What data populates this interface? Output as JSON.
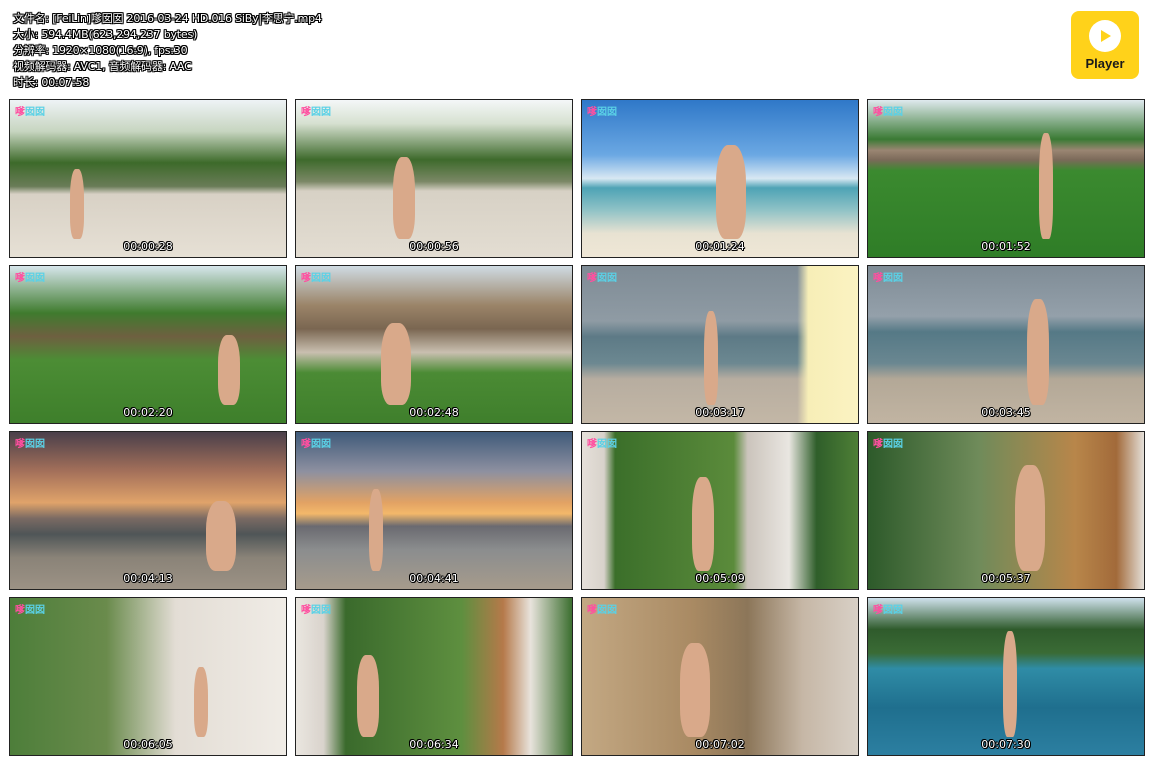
{
  "meta": {
    "filename": "文件名: [FeiLin]嗲囡囡 2016-03-24 HD.016 SiBy|李思宁.mp4",
    "size": "大小: 594.4MB(623,294,237 bytes)",
    "resolution": "分辨率: 1920×1080(16:9), fps:30",
    "codecs": "视频解码器: AVC1, 音频解码器: AAC",
    "duration": "时长: 00:07:58"
  },
  "player": {
    "label": "Player",
    "icon": "play-icon",
    "color": "#ffd21a"
  },
  "logo": {
    "primary": "嗲",
    "secondary": "囡囡"
  },
  "thumbnails": [
    {
      "time": "00:00:28",
      "scene": "s-palm-sand"
    },
    {
      "time": "00:00:56",
      "scene": "s-palm-sand2"
    },
    {
      "time": "00:01:24",
      "scene": "s-sea-sky"
    },
    {
      "time": "00:01:52",
      "scene": "s-lawn"
    },
    {
      "time": "00:02:20",
      "scene": "s-garden"
    },
    {
      "time": "00:02:48",
      "scene": "s-hut"
    },
    {
      "time": "00:03:17",
      "scene": "s-grey-sea"
    },
    {
      "time": "00:03:45",
      "scene": "s-grey-sea2"
    },
    {
      "time": "00:04:13",
      "scene": "s-sunset"
    },
    {
      "time": "00:04:41",
      "scene": "s-sunset2"
    },
    {
      "time": "00:05:09",
      "scene": "s-room"
    },
    {
      "time": "00:05:37",
      "scene": "s-room2"
    },
    {
      "time": "00:06:05",
      "scene": "s-room3"
    },
    {
      "time": "00:06:34",
      "scene": "s-room4"
    },
    {
      "time": "00:07:02",
      "scene": "s-room5"
    },
    {
      "time": "00:07:30",
      "scene": "s-pool"
    }
  ]
}
